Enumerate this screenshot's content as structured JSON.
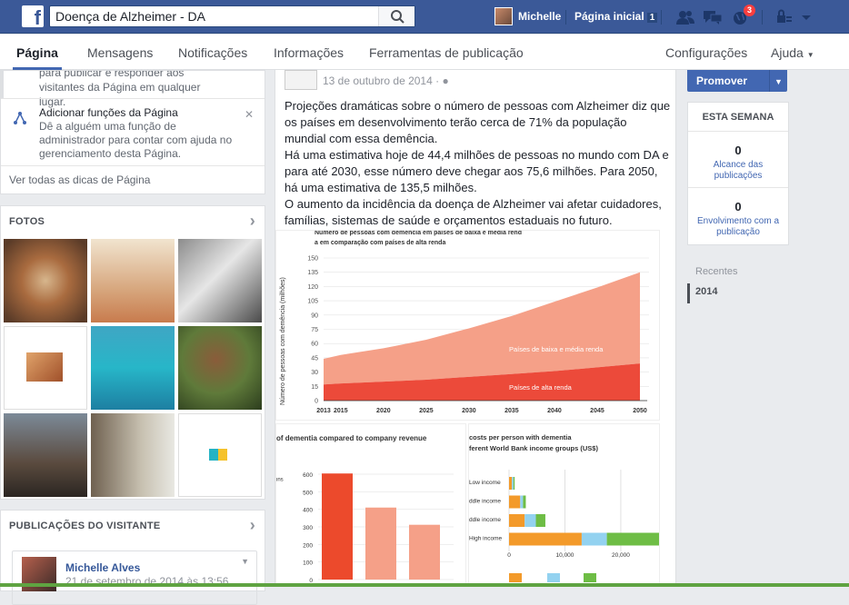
{
  "topbar": {
    "search_value": "Doença de Alzheimer - DA",
    "user_name": "Michelle",
    "home_label": "Página inicial",
    "home_count": "1",
    "notif_badge": "3",
    "brand_color": "#3b5998"
  },
  "nav": {
    "tabs": [
      "Página",
      "Mensagens",
      "Notificações",
      "Informações",
      "Ferramentas de publicação"
    ],
    "settings": "Configurações",
    "help": "Ajuda"
  },
  "tips": {
    "tip1_text": "para publicar e responder aos visitantes da Página em qualquer lugar.",
    "tip2_title": "Adicionar funções da Página",
    "tip2_desc": "Dê a alguém uma função de administrador para contar com ajuda no gerenciamento desta Página.",
    "see_all": "Ver todas as dicas de Página"
  },
  "photos": {
    "header": "FOTOS"
  },
  "visitors": {
    "header": "PUBLICAÇÕES DO VISITANTE",
    "author": "Michelle Alves",
    "date": "21 de setembro de 2014 às 13:56"
  },
  "post": {
    "date": "13 de outubro de 2014 ·",
    "p1": "Projeções dramáticas sobre o número de pessoas com Alzheimer diz que os países em desenvolvimento terão cerca de 71% da população mundial com essa demência.",
    "p2": "Há uma estimativa hoje de 44,4 milhões de pessoas no mundo com DA e para até 2030, esse número deve chegar aos 75,6 milhões. Para 2050, há uma estimativa de 135,5 milhões.",
    "p3": "O aumento da incidência da doença de Alzheimer vai afetar cuidadores, famílias, sistemas de saúde e orçamentos estaduais no futuro."
  },
  "right": {
    "promote": "Promover",
    "week_header": "ESTA SEMANA",
    "reach_value": "0",
    "reach_label": "Alcance das publicações",
    "engagement_value": "0",
    "engagement_label": "Envolvimento com a publicação",
    "years": [
      "Recentes",
      "2014"
    ]
  },
  "chart_data": [
    {
      "type": "area",
      "title": "Número de pessoas com demência em países de baixa e média renda em comparação com países de alta renda",
      "ylabel": "Número de pessoas com demência (milhões)",
      "x": [
        2013,
        2015,
        2020,
        2025,
        2030,
        2035,
        2040,
        2045,
        2050
      ],
      "ylim": [
        0,
        150
      ],
      "yticks": [
        0,
        15,
        30,
        45,
        60,
        75,
        90,
        105,
        120,
        135,
        150
      ],
      "series": [
        {
          "name": "Países de alta renda",
          "color": "#ec4a3a",
          "values": [
            17,
            18,
            20,
            22,
            25,
            28,
            31,
            35,
            39
          ]
        },
        {
          "name": "Países de baixa e média renda",
          "color": "#f5a088",
          "values": [
            44,
            48,
            55,
            64,
            76,
            89,
            104,
            119,
            135
          ]
        }
      ]
    },
    {
      "type": "bar",
      "title": "of dementia compared to company revenue",
      "tick_labels": [
        "600",
        "500",
        "400",
        "300",
        "200",
        "100",
        "0"
      ],
      "unit_fragment": "llions",
      "ylim": [
        0,
        600
      ],
      "values": [
        604,
        410,
        312
      ],
      "colors": [
        "#ec4a2c",
        "#f5a088",
        "#f5a088"
      ]
    },
    {
      "type": "bar",
      "title_line1": "costs per person with dementia",
      "title_line2": "ferent World Bank income groups (US$)",
      "categories": [
        "Low income",
        "ddle income",
        "ddle income",
        "High income"
      ],
      "xticks": [
        "0",
        "10,000",
        "20,000"
      ],
      "xlim": [
        0,
        27000
      ],
      "segments": [
        [
          {
            "v": 500,
            "c": "#f39a2a"
          },
          {
            "v": 300,
            "c": "#93d2f0"
          },
          {
            "v": 200,
            "c": "#6ebd45"
          }
        ],
        [
          {
            "v": 2000,
            "c": "#f39a2a"
          },
          {
            "v": 500,
            "c": "#93d2f0"
          },
          {
            "v": 500,
            "c": "#6ebd45"
          }
        ],
        [
          {
            "v": 2800,
            "c": "#f39a2a"
          },
          {
            "v": 2000,
            "c": "#93d2f0"
          },
          {
            "v": 1700,
            "c": "#6ebd45"
          }
        ],
        [
          {
            "v": 13000,
            "c": "#f39a2a"
          },
          {
            "v": 4500,
            "c": "#93d2f0"
          },
          {
            "v": 9500,
            "c": "#6ebd45"
          }
        ]
      ]
    }
  ]
}
